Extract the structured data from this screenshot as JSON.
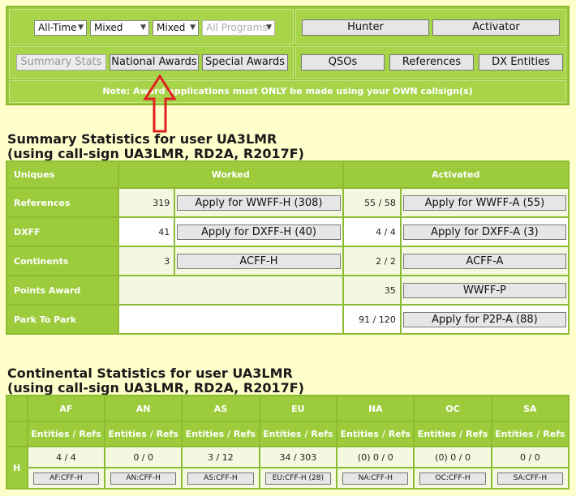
{
  "filters": {
    "period": "All-Time",
    "mode1": "Mixed",
    "mode2": "Mixed",
    "programs": "All Programs"
  },
  "role_buttons": {
    "hunter": "Hunter",
    "activator": "Activator"
  },
  "tabs": {
    "summary": "Summary Stats",
    "national": "National Awards",
    "special": "Special Awards"
  },
  "ref_buttons": {
    "qsos": "QSOs",
    "references": "References",
    "dx": "DX Entities"
  },
  "note": "Note: Award applications must ONLY be made using your OWN callsign(s)",
  "summary": {
    "title1": "Summary Statistics for user UA3LMR",
    "title2": "(using call-sign UA3LMR, RD2A, R2017F)",
    "headers": {
      "uniques": "Uniques",
      "worked": "Worked",
      "activated": "Activated"
    },
    "rows": [
      {
        "label": "References",
        "worked": "319",
        "worked_btn": "Apply for WWFF-H (308)",
        "activated": "55 / 58",
        "activated_btn": "Apply for WWFF-A (55)"
      },
      {
        "label": "DXFF",
        "worked": "41",
        "worked_btn": "Apply for DXFF-H (40)",
        "activated": "4 / 4",
        "activated_btn": "Apply for DXFF-A (3)"
      },
      {
        "label": "Continents",
        "worked": "3",
        "worked_btn": "ACFF-H",
        "activated": "2 / 2",
        "activated_btn": "ACFF-A"
      },
      {
        "label": "Points Award",
        "worked": "",
        "worked_btn": "",
        "activated": "35",
        "activated_btn": "WWFF-P"
      },
      {
        "label": "Park To Park",
        "worked": "",
        "worked_btn": "",
        "activated": "91 / 120",
        "activated_btn": "Apply for P2P-A (88)"
      }
    ]
  },
  "continental": {
    "title1": "Continental Statistics for user UA3LMR",
    "title2": "(using call-sign UA3LMR, RD2A, R2017F)",
    "subheader": "Entities / Refs",
    "row_label": "H",
    "continents": [
      {
        "code": "AF",
        "value": "4 / 4",
        "btn": "AF:CFF-H"
      },
      {
        "code": "AN",
        "value": "0 / 0",
        "btn": "AN:CFF-H"
      },
      {
        "code": "AS",
        "value": "3 / 12",
        "btn": "AS:CFF-H"
      },
      {
        "code": "EU",
        "value": "34 / 303",
        "btn": "EU:CFF-H (28)"
      },
      {
        "code": "NA",
        "value": "(0) 0 / 0",
        "btn": "NA:CFF-H"
      },
      {
        "code": "OC",
        "value": "(0) 0 / 0",
        "btn": "OC:CFF-H"
      },
      {
        "code": "SA",
        "value": "0 / 0",
        "btn": "SA:CFF-H"
      }
    ]
  },
  "colors": {
    "page_bg": "#ffffcc",
    "accent_green": "#9ccc3c",
    "arrow_red": "#e02020"
  }
}
